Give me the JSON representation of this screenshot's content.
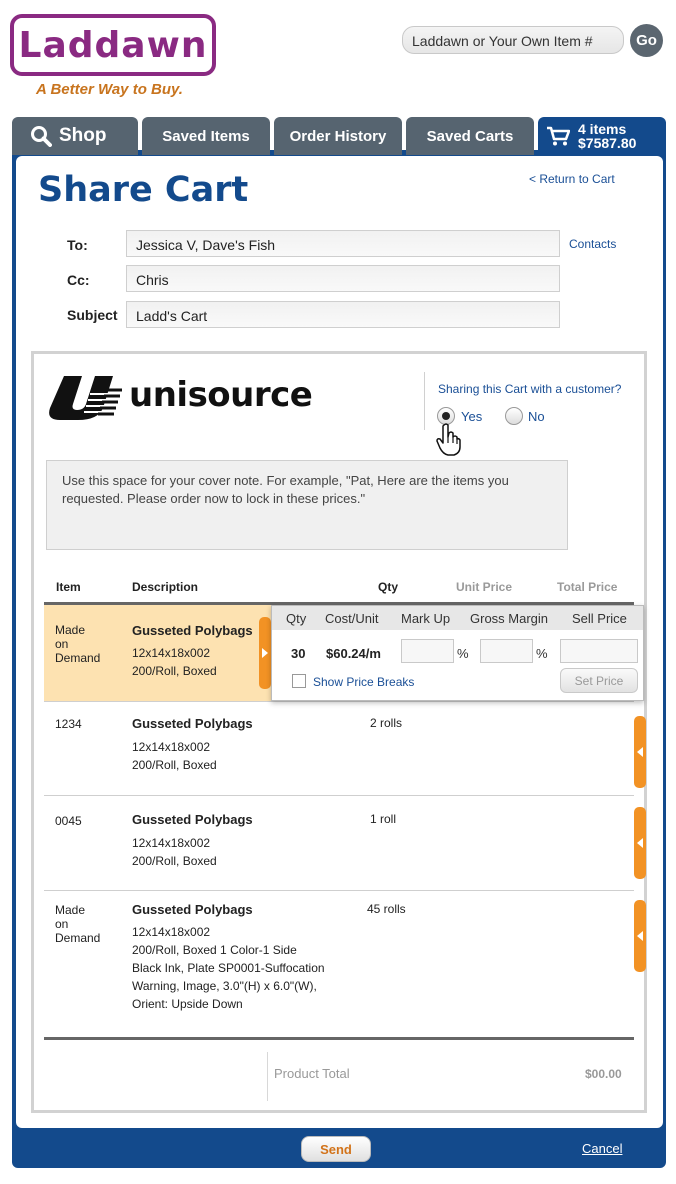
{
  "header": {
    "logo_text": "Laddawn",
    "tagline": "A Better Way to Buy.",
    "search_placeholder": "Laddawn or Your Own Item #",
    "go_label": "Go"
  },
  "tabs": [
    {
      "label": "Shop"
    },
    {
      "label": "Saved Items"
    },
    {
      "label": "Order History"
    },
    {
      "label": "Saved Carts"
    }
  ],
  "cart": {
    "items": "4 items",
    "total": "$7587.80"
  },
  "page": {
    "title": "Share Cart",
    "return_link": "< Return to Cart"
  },
  "form": {
    "to_label": "To:",
    "to_value": "Jessica V, Dave's Fish",
    "contacts_link": "Contacts",
    "cc_label": "Cc:",
    "cc_value": "Chris",
    "subject_label": "Subject",
    "subject_value": "Ladd's Cart"
  },
  "document": {
    "brand": "unisource",
    "share_question": "Sharing this Cart with a customer?",
    "yes_label": "Yes",
    "no_label": "No",
    "selected": "Yes",
    "cover_note_placeholder": "Use this space for your cover note. For example, \"Pat, Here are the items you requested. Please order now to lock in these prices.\""
  },
  "table": {
    "headers": {
      "item": "Item",
      "description": "Description",
      "qty": "Qty",
      "unit_price": "Unit Price",
      "total_price": "Total Price"
    },
    "rows": [
      {
        "item": [
          "Made",
          "on",
          "Demand"
        ],
        "name": "Gusseted Polybags",
        "desc": [
          "12x14x18x002",
          "200/Roll, Boxed"
        ],
        "qty": ""
      },
      {
        "item": [
          "1234"
        ],
        "name": "Gusseted Polybags",
        "desc": [
          "12x14x18x002",
          "200/Roll, Boxed"
        ],
        "qty": "2 rolls"
      },
      {
        "item": [
          "0045"
        ],
        "name": "Gusseted Polybags",
        "desc": [
          "12x14x18x002",
          "200/Roll, Boxed"
        ],
        "qty": "1 roll"
      },
      {
        "item": [
          "Made",
          "on",
          "Demand"
        ],
        "name": "Gusseted Polybags",
        "desc": [
          "12x14x18x002",
          "200/Roll, Boxed  1 Color-1 Side",
          "Black Ink, Plate SP0001-Suffocation",
          "Warning, Image, 3.0\"(H) x 6.0\"(W),",
          "Orient: Upside Down"
        ],
        "qty": "45 rolls"
      }
    ]
  },
  "popup": {
    "headers": {
      "qty": "Qty",
      "cost_unit": "Cost/Unit",
      "mark_up": "Mark Up",
      "gross_margin": "Gross Margin",
      "sell_price": "Sell Price"
    },
    "qty": "30",
    "cost_unit": "$60.24/m",
    "pct_symbol": "%",
    "show_price_breaks": "Show Price Breaks",
    "set_price": "Set Price"
  },
  "totals": {
    "label": "Product Total",
    "value": "$00.00"
  },
  "footer": {
    "send": "Send",
    "cancel": "Cancel"
  },
  "colors": {
    "brand_purple": "#8a2a82",
    "brand_blue": "#134a8c",
    "accent_orange": "#f29224",
    "tab_gray": "#566470"
  }
}
